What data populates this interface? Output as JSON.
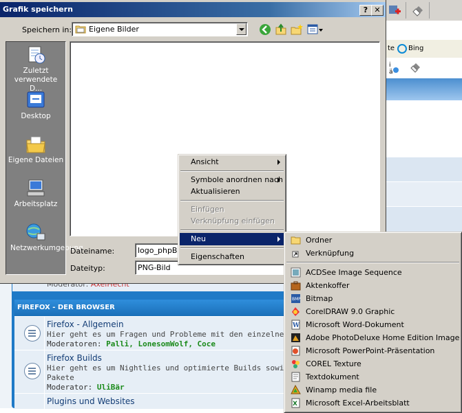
{
  "dialog": {
    "title": "Grafik speichern",
    "help_btn": "?",
    "close_btn": "✕",
    "save_in_label": "Speichern in:",
    "save_in_value": "Eigene Bilder",
    "filename_label": "Dateiname:",
    "filename_value": "logo_phpBB",
    "filetype_label": "Dateityp:",
    "filetype_value": "PNG-Bild",
    "places": [
      {
        "label": "Zuletzt verwendete D...",
        "icon": "recent-docs-icon"
      },
      {
        "label": "Desktop",
        "icon": "desktop-icon"
      },
      {
        "label": "Eigene Dateien",
        "icon": "my-documents-icon"
      },
      {
        "label": "Arbeitsplatz",
        "icon": "my-computer-icon"
      },
      {
        "label": "Netzwerkumgebung",
        "icon": "network-icon"
      }
    ]
  },
  "context_menu": {
    "items": {
      "view": "Ansicht",
      "arrange": "Symbole anordnen nach",
      "refresh": "Aktualisieren",
      "paste": "Einfügen",
      "paste_link": "Verknüpfung einfügen",
      "new": "Neu",
      "properties": "Eigenschaften"
    }
  },
  "new_submenu": {
    "folder": "Ordner",
    "shortcut": "Verknüpfung",
    "files": [
      {
        "label": "ACDSee Image Sequence",
        "icon": "acdsee-icon"
      },
      {
        "label": "Aktenkoffer",
        "icon": "briefcase-icon"
      },
      {
        "label": "Bitmap",
        "icon": "bitmap-icon"
      },
      {
        "label": "CorelDRAW 9.0 Graphic",
        "icon": "coreldraw-icon"
      },
      {
        "label": "Microsoft Word-Dokument",
        "icon": "word-icon"
      },
      {
        "label": "Adobe PhotoDeluxe Home Edition Image",
        "icon": "photodeluxe-icon"
      },
      {
        "label": "Microsoft PowerPoint-Präsentation",
        "icon": "powerpoint-icon"
      },
      {
        "label": "COREL Texture",
        "icon": "corel-texture-icon"
      },
      {
        "label": "Textdokument",
        "icon": "text-document-icon"
      },
      {
        "label": "Winamp media file",
        "icon": "winamp-icon"
      },
      {
        "label": "Microsoft Excel-Arbeitsblatt",
        "icon": "excel-icon"
      }
    ]
  },
  "background": {
    "bing_label": "Bing",
    "bing_prefix": "te",
    "prev_moderator_label": "Moderator:",
    "prev_moderator": "AxelHecht",
    "section_title": "FIREFOX - DER BROWSER",
    "forums": [
      {
        "title": "Firefox - Allgemein",
        "desc": "Hier geht es um Fragen und Probleme mit den einzelnen Fire",
        "mods_label": "Moderatoren:",
        "mods": "Palli, LonesomWolf, Coce"
      },
      {
        "title": "Firefox Builds",
        "desc": "Hier geht es um Nightlies und optimierte Builds sowie Betrie",
        "desc2": "Pakete",
        "mods_label": "Moderator:",
        "mods": "UliBär"
      },
      {
        "title": "Plugins und Websites"
      }
    ]
  }
}
